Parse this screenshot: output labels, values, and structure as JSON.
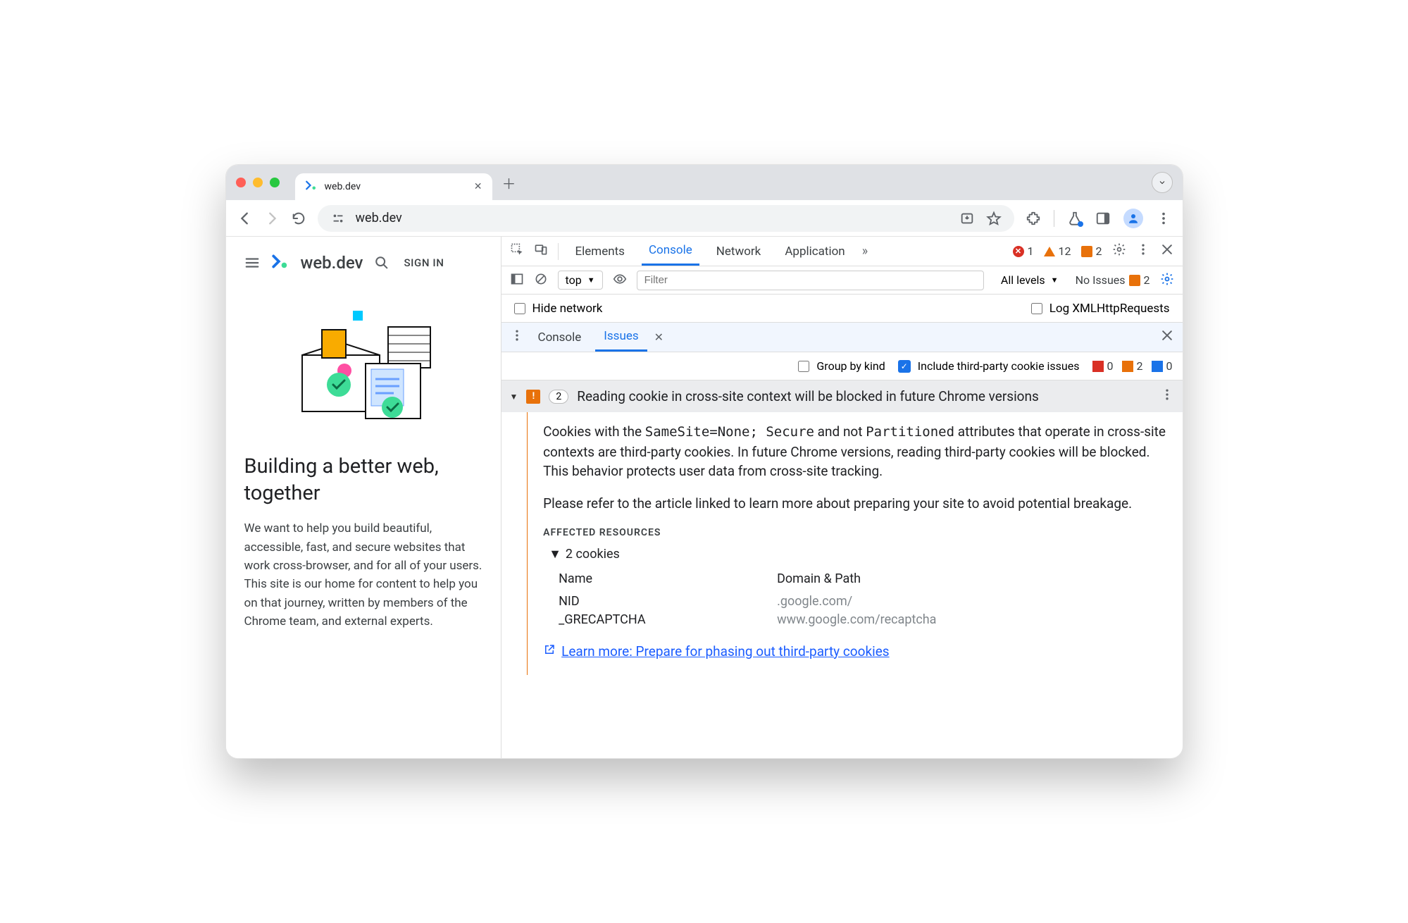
{
  "browser": {
    "tab_title": "web.dev",
    "url": "web.dev"
  },
  "page": {
    "brand": "web.dev",
    "signin": "SIGN IN",
    "headline": "Building a better web, together",
    "paragraph": "We want to help you build beautiful, accessible, fast, and secure websites that work cross-browser, and for all of your users. This site is our home for content to help you on that journey, written by members of the Chrome team, and external experts."
  },
  "devtools": {
    "tabs": {
      "elements": "Elements",
      "console": "Console",
      "network": "Network",
      "application": "Application"
    },
    "counts": {
      "errors": "1",
      "warnings": "12",
      "bookmarks": "2"
    },
    "console_bar": {
      "context": "top",
      "filter_placeholder": "Filter",
      "levels": "All levels",
      "no_issues": "No Issues",
      "no_issues_count": "2"
    },
    "checks": {
      "hide_network": "Hide network",
      "log_xhr": "Log XMLHttpRequests"
    },
    "drawer": {
      "console": "Console",
      "issues": "Issues"
    },
    "issues_filters": {
      "group": "Group by kind",
      "thirdparty": "Include third-party cookie issues",
      "red": "0",
      "orange": "2",
      "blue": "0"
    },
    "issue": {
      "count": "2",
      "title": "Reading cookie in cross-site context will be blocked in future Chrome versions",
      "p1a": "Cookies with the ",
      "p1code1": "SameSite=None; Secure",
      "p1b": " and not ",
      "p1code2": "Partitioned",
      "p1c": " attributes that operate in cross-site contexts are third-party cookies. In future Chrome versions, reading third-party cookies will be blocked. This behavior protects user data from cross-site tracking.",
      "p2": "Please refer to the article linked to learn more about preparing your site to avoid potential breakage.",
      "affected_label": "AFFECTED RESOURCES",
      "cookies_summary": "2 cookies",
      "table": {
        "h1": "Name",
        "h2": "Domain & Path",
        "rows": [
          {
            "name": "NID",
            "domain": ".google.com/"
          },
          {
            "name": "_GRECAPTCHA",
            "domain": "www.google.com/recaptcha"
          }
        ]
      },
      "learn_more": "Learn more: Prepare for phasing out third-party cookies"
    }
  }
}
